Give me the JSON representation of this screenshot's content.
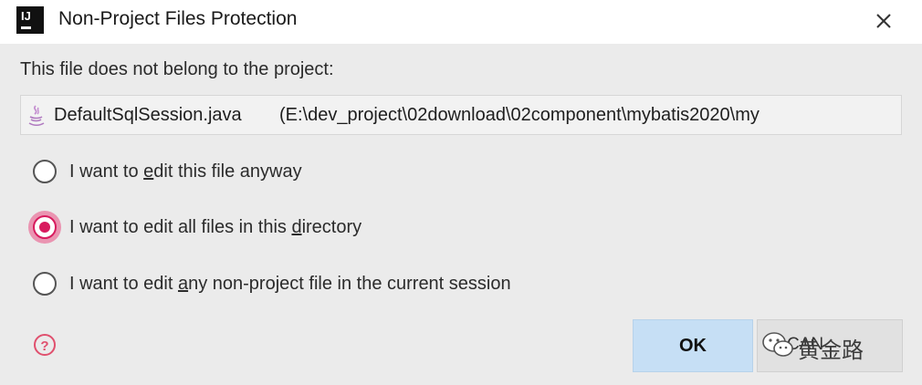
{
  "window": {
    "app_icon_text": "IJ",
    "title": "Non-Project Files Protection",
    "close_icon": "close-icon"
  },
  "dialog": {
    "message": "This file does not belong to the project:",
    "file": {
      "icon": "java-file-icon",
      "name": "DefaultSqlSession.java",
      "path": "(E:\\dev_project\\02download\\02component\\mybatis2020\\my"
    },
    "options": [
      {
        "pre": "I want to ",
        "mnemonic": "e",
        "post": "dit this file anyway",
        "selected": false
      },
      {
        "pre": "I want to edit all files in this ",
        "mnemonic": "d",
        "post": "irectory",
        "selected": true
      },
      {
        "pre": "I want to edit ",
        "mnemonic": "a",
        "post": "ny non-project file in the current session",
        "selected": false
      }
    ],
    "help_icon": "help-icon",
    "accent_color": "#d81b5e"
  },
  "buttons": {
    "ok_label": "OK",
    "cancel_label": "CAN"
  },
  "watermark": {
    "icon": "wechat-icon",
    "text": "黄金路"
  }
}
